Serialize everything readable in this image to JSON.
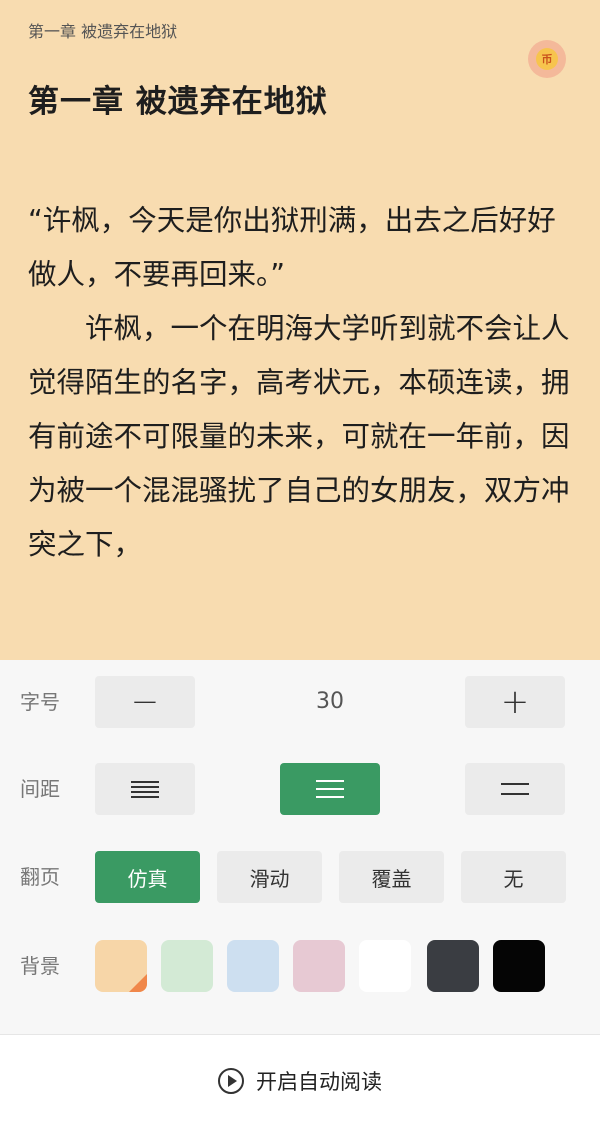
{
  "header": {
    "small_title": "第一章  被遗弃在地狱",
    "coin_glyph": "币"
  },
  "chapter": {
    "title": "第一章  被遗弃在地狱",
    "paragraphs": [
      "“许枫，今天是你出狱刑满，出去之后好好做人，不要再回来。”",
      "许枫，一个在明海大学听到就不会让人觉得陌生的名字，高考状元，本硕连读，拥有前途不可限量的未来，可就在一年前，因为被一个混混骚扰了自己的女朋友，双方冲突之下，"
    ]
  },
  "settings": {
    "font_size": {
      "label": "字号",
      "value": "30",
      "decrease": "−",
      "increase": "+"
    },
    "spacing": {
      "label": "间距",
      "options": [
        "compact-lines-icon",
        "normal-lines-icon",
        "loose-lines-icon"
      ],
      "selected_index": 1
    },
    "page_turn": {
      "label": "翻页",
      "options": [
        "仿真",
        "滑动",
        "覆盖",
        "无"
      ],
      "selected_index": 0
    },
    "background": {
      "label": "背景",
      "colors": [
        "#f7d6a8",
        "#d3ead5",
        "#cddff0",
        "#e7c9d3",
        "#ffffff",
        "#3a3d42",
        "#050505"
      ],
      "selected_index": 0
    }
  },
  "auto_read": {
    "label": "开启自动阅读",
    "icon": "play-circle-icon"
  },
  "colors": {
    "accent": "#3a9a63",
    "reader_bg": "#f8dcb0",
    "selected_corner": "#f0874a"
  }
}
